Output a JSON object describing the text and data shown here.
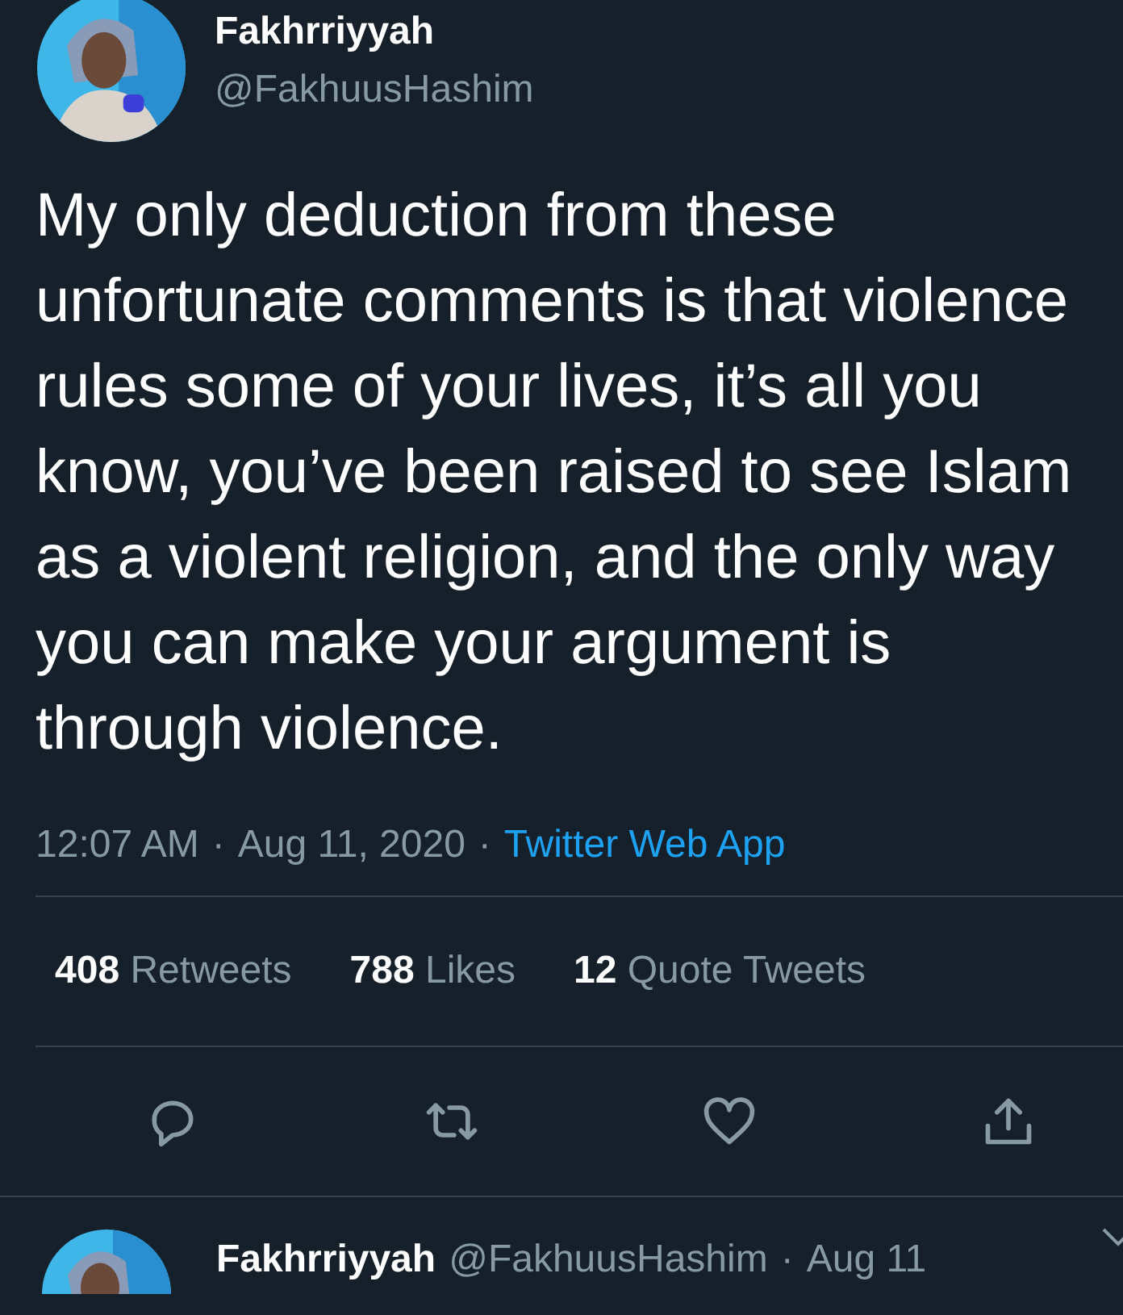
{
  "tweet": {
    "author": {
      "name": "Fakhrriyyah",
      "handle": "@FakhuusHashim"
    },
    "text": "My only deduction from these unfortunate comments is that violence rules some of your lives, it’s all you know, you’ve been raised to see Islam as a violent religion, and the only way you can make your argument is through violence.",
    "time": "12:07 AM",
    "separator": "·",
    "date": "Aug 11, 2020",
    "source": "Twitter Web App",
    "stats": [
      {
        "count": "408",
        "label": "Retweets"
      },
      {
        "count": "788",
        "label": "Likes"
      },
      {
        "count": "12",
        "label": "Quote Tweets"
      }
    ],
    "actions": [
      {
        "kind": "reply"
      },
      {
        "kind": "retweet"
      },
      {
        "kind": "like"
      },
      {
        "kind": "share"
      }
    ]
  },
  "reply": {
    "author": {
      "name": "Fakhrriyyah",
      "handle": "@FakhuusHashim"
    },
    "separator": "·",
    "date": "Aug 11"
  }
}
